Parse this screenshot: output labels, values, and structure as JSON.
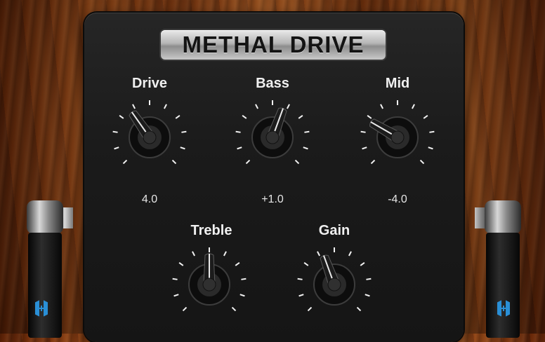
{
  "pedal": {
    "title": "METHAL DRIVE"
  },
  "controls": [
    {
      "id": "drive",
      "label": "Drive",
      "value": "4.0",
      "angle": 145
    },
    {
      "id": "bass",
      "label": "Bass",
      "value": "+1.0",
      "angle": 200
    },
    {
      "id": "mid",
      "label": "Mid",
      "value": "-4.0",
      "angle": 120
    },
    {
      "id": "treble",
      "label": "Treble",
      "value": "",
      "angle": 180
    },
    {
      "id": "gain",
      "label": "Gain",
      "value": "",
      "angle": 160
    }
  ],
  "colors": {
    "knob": "#1e1e1e",
    "tick": "#f2f2f2",
    "jack_logo": "#2a8fd6"
  },
  "icons": {
    "left_jack_logo": "jack-logo-icon",
    "right_jack_logo": "jack-logo-icon"
  }
}
